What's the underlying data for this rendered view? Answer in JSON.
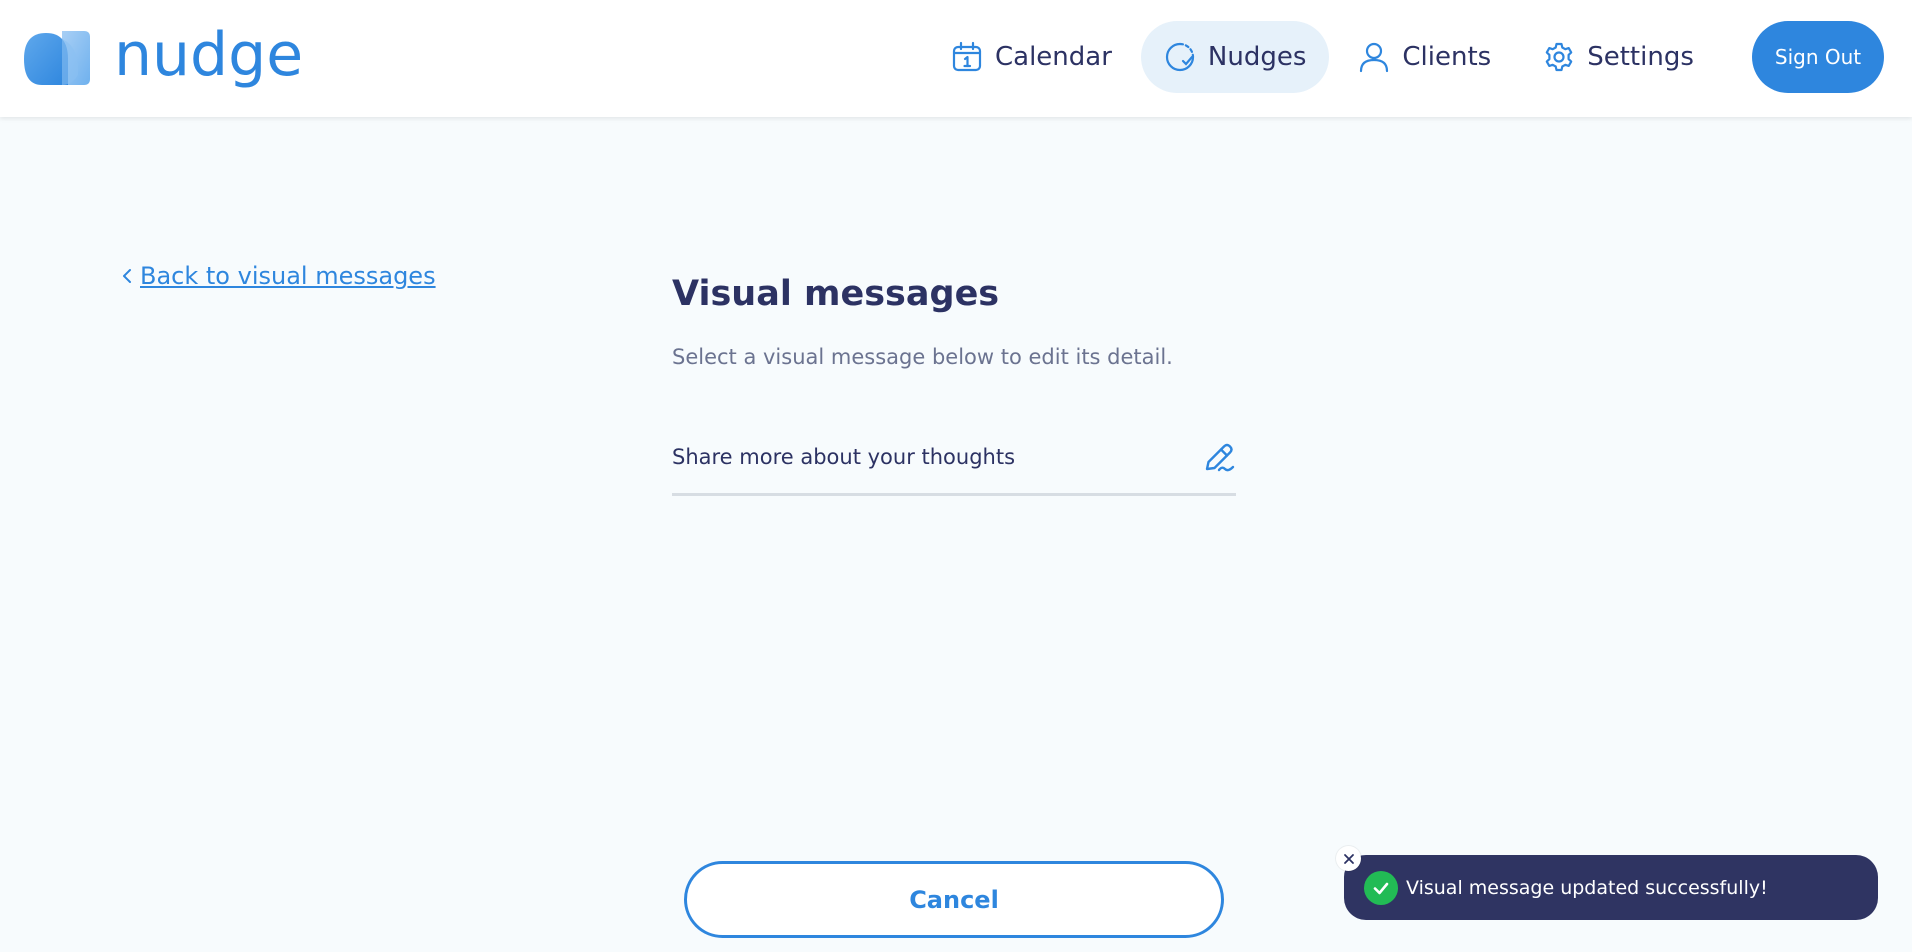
{
  "brand": {
    "name": "nudge",
    "color": "#2e86de",
    "logo_icon": "nudge-logo-icon"
  },
  "nav": {
    "items": [
      {
        "label": "Calendar",
        "icon": "calendar-icon",
        "active": false
      },
      {
        "label": "Nudges",
        "icon": "nudges-icon",
        "active": true
      },
      {
        "label": "Clients",
        "icon": "user-icon",
        "active": false
      },
      {
        "label": "Settings",
        "icon": "gear-icon",
        "active": false
      }
    ],
    "sign_out_label": "Sign Out"
  },
  "main": {
    "back_link_label": "Back to visual messages",
    "title": "Visual messages",
    "subtitle": "Select a visual message below to edit its detail.",
    "messages": [
      {
        "label": "Share more about your thoughts",
        "icon": "edit-pen-icon"
      }
    ],
    "cancel_label": "Cancel"
  },
  "toast": {
    "message": "Visual message updated successfully!",
    "status": "success",
    "status_color": "#22bb55",
    "background": "#2f3462"
  }
}
